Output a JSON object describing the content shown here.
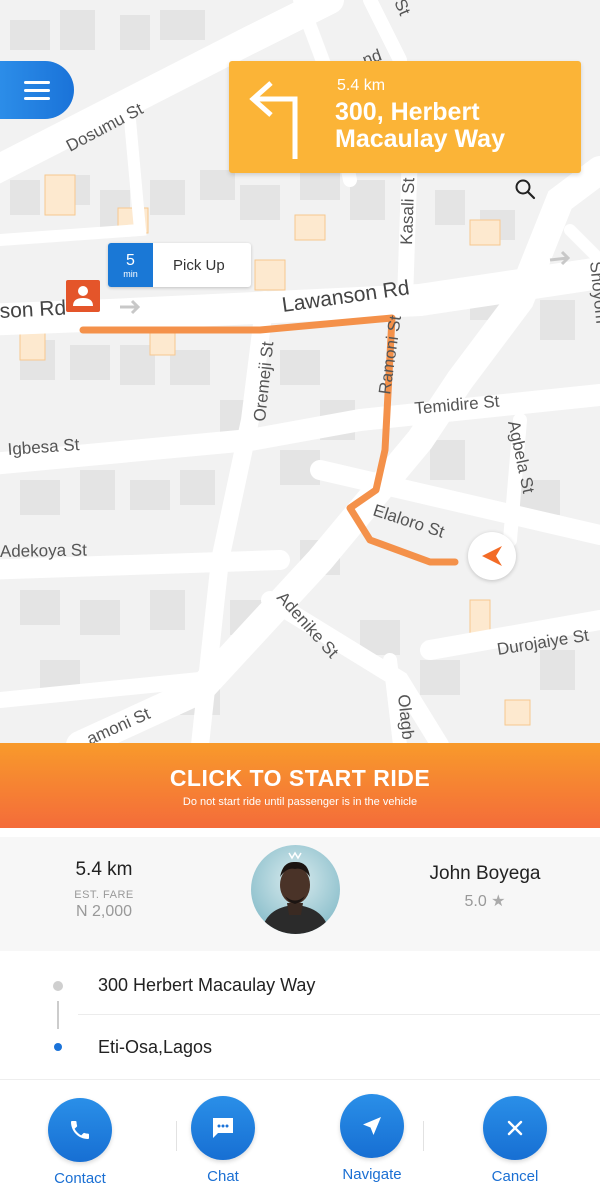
{
  "map": {
    "streets": {
      "dosumu": "Dosumu St",
      "lawanson": "Lawanson Rd",
      "lawanson_left": "son Rd",
      "kasali": "Kasali St",
      "oremeji": "Oremeji St",
      "ramoni": "Ramoni St",
      "temidire": "Temidire St",
      "agbela": "Agbela St",
      "igbesa": "Igbesa St",
      "adekoya": "Adekoya St",
      "elaloro": "Elaloro St",
      "adenike": "Adenike St",
      "durojaiye": "Durojaiye St",
      "amoni": "amoni St",
      "olagb": "Olagb",
      "shoyombo": "Shoyom",
      "top_st": "St",
      "top_nd": "nd"
    },
    "route_color": "#f4914a",
    "icons": {
      "menu": "menu-icon",
      "turn": "turn-left-icon",
      "search": "search-icon",
      "pin": "person-pin-icon",
      "car": "navigation-arrow-icon"
    }
  },
  "direction": {
    "distance": "5.4 km",
    "street": "300, Herbert Macaulay Way",
    "color": "#fbb437"
  },
  "pickup": {
    "minutes": "5",
    "unit": "min",
    "label": "Pick Up"
  },
  "start_ride": {
    "title": "CLICK TO START RIDE",
    "subtitle": "Do not start ride until passenger is in the vehicle"
  },
  "trip": {
    "distance": "5.4 km",
    "fare_label": "EST. FARE",
    "fare_value": "N 2,000"
  },
  "rider": {
    "name": "John Boyega",
    "rating": "5.0"
  },
  "addresses": {
    "from": "300 Herbert Macaulay Way",
    "to": "Eti-Osa,Lagos"
  },
  "actions": [
    {
      "label": "Contact",
      "icon": "phone-icon"
    },
    {
      "label": "Chat",
      "icon": "chat-icon"
    },
    {
      "label": "Navigate",
      "icon": "navigate-icon"
    },
    {
      "label": "Cancel",
      "icon": "close-icon"
    }
  ],
  "accent": "#1a73d9",
  "cta_gradient": [
    "#f89a2b",
    "#f46c3a"
  ]
}
